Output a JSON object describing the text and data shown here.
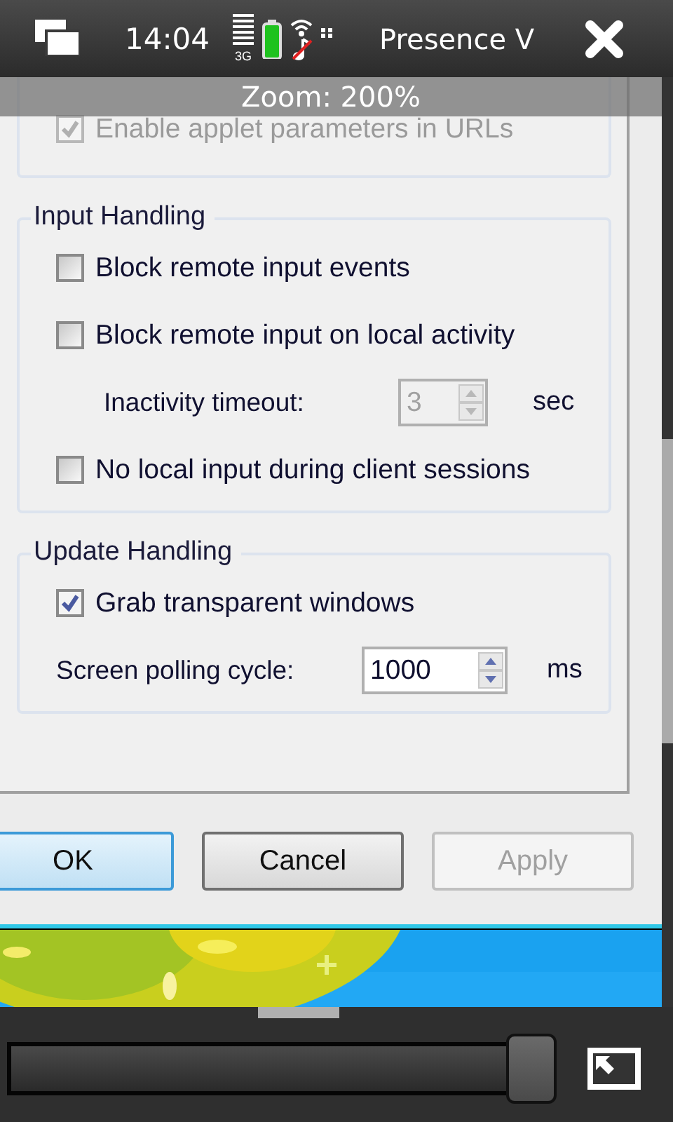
{
  "status_bar": {
    "time": "14:04",
    "network": "3G",
    "app_title": "Presence V"
  },
  "zoom_notice": "Zoom: 200%",
  "groups": [
    {
      "items": [
        {
          "kind": "checkbox",
          "label": "Enable applet parameters in URLs",
          "checked": true,
          "disabled": true
        }
      ]
    },
    {
      "title": "Input Handling",
      "items": [
        {
          "kind": "checkbox",
          "label": "Block remote input events",
          "checked": false,
          "disabled": false
        },
        {
          "kind": "checkbox",
          "label": "Block remote input on local activity",
          "checked": false,
          "disabled": false
        },
        {
          "kind": "spinner",
          "label": "Inactivity timeout:",
          "value": "3",
          "unit": "sec",
          "disabled": true,
          "indented": true
        },
        {
          "kind": "checkbox",
          "label": "No local input during client sessions",
          "checked": false,
          "disabled": false
        }
      ]
    },
    {
      "title": "Update Handling",
      "items": [
        {
          "kind": "checkbox",
          "label": "Grab transparent windows",
          "checked": true,
          "disabled": false
        },
        {
          "kind": "spinner",
          "label": "Screen polling cycle:",
          "value": "1000",
          "unit": "ms",
          "disabled": false,
          "indented": false
        }
      ]
    }
  ],
  "buttons": [
    {
      "label": "OK",
      "kind": "default"
    },
    {
      "label": "Cancel",
      "kind": "normal"
    },
    {
      "label": "Apply",
      "kind": "disabled"
    }
  ],
  "zoom_slider": {
    "level": 1.0
  }
}
